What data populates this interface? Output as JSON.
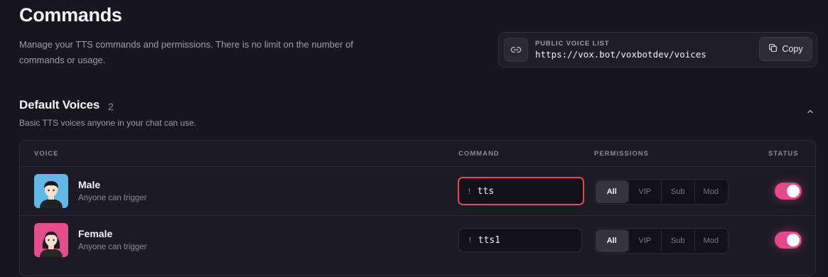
{
  "header": {
    "title": "Commands",
    "description": "Manage your TTS commands and permissions. There is no limit on the number of commands or usage."
  },
  "voice_list": {
    "label": "PUBLIC VOICE LIST",
    "url": "https://vox.bot/voxbotdev/voices",
    "copy_label": "Copy",
    "icon": "link-icon"
  },
  "section": {
    "title": "Default Voices",
    "count": "2",
    "description": "Basic TTS voices anyone in your chat can use."
  },
  "table": {
    "headers": {
      "voice": "VOICE",
      "command": "COMMAND",
      "permissions": "PERMISSIONS",
      "status": "STATUS"
    },
    "rows": [
      {
        "name": "Male",
        "subtitle": "Anyone can trigger",
        "command_prefix": "!",
        "command": "tts",
        "permissions": [
          "All",
          "VIP",
          "Sub",
          "Mod"
        ],
        "selected_permission": "All",
        "status_on": true,
        "avatar_bg": "#5fb8e6"
      },
      {
        "name": "Female",
        "subtitle": "Anyone can trigger",
        "command_prefix": "!",
        "command": "tts1",
        "permissions": [
          "All",
          "VIP",
          "Sub",
          "Mod"
        ],
        "selected_permission": "All",
        "status_on": true,
        "avatar_bg": "#e64d8c"
      }
    ]
  },
  "colors": {
    "background": "#17161f",
    "accent": "#e8468f",
    "focus_border": "#e24a4f"
  }
}
